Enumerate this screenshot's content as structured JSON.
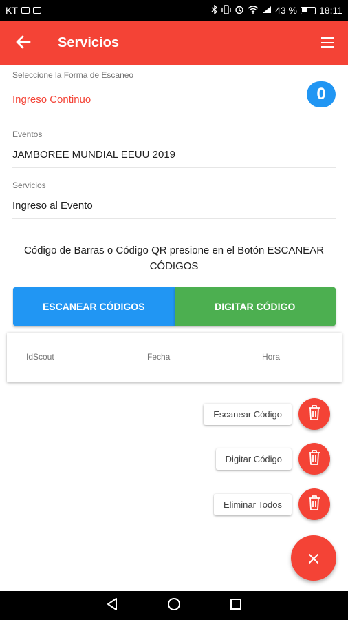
{
  "status_bar": {
    "carrier": "KT",
    "battery_percent": "43 %",
    "time": "18:11"
  },
  "app_bar": {
    "title": "Servicios",
    "back_icon": "arrow-left-icon",
    "menu_icon": "hamburger-menu-icon"
  },
  "form": {
    "scan_mode": {
      "label": "Seleccione la Forma de Escaneo",
      "value": "Ingreso Continuo"
    },
    "counter": "0",
    "events": {
      "label": "Eventos",
      "value": "JAMBOREE MUNDIAL EEUU 2019"
    },
    "services": {
      "label": "Servicios",
      "value": "Ingreso al Evento"
    }
  },
  "instruction": "Código de Barras o Código QR presione en el Botón ESCANEAR CÓDIGOS",
  "buttons": {
    "scan": "ESCANEAR CÓDIGOS",
    "type_code": "DIGITAR CÓDIGO"
  },
  "table": {
    "headers": [
      "IdScout",
      "Fecha",
      "Hora"
    ]
  },
  "fab_menu": {
    "items": [
      {
        "label": "Escanear Código",
        "icon": "trash-icon"
      },
      {
        "label": "Digitar Código",
        "icon": "trash-icon"
      },
      {
        "label": "Eliminar Todos",
        "icon": "trash-icon"
      }
    ],
    "main_icon": "close-icon"
  },
  "colors": {
    "primary": "#f44336",
    "accent_blue": "#2196f3",
    "accent_green": "#4caf50"
  }
}
